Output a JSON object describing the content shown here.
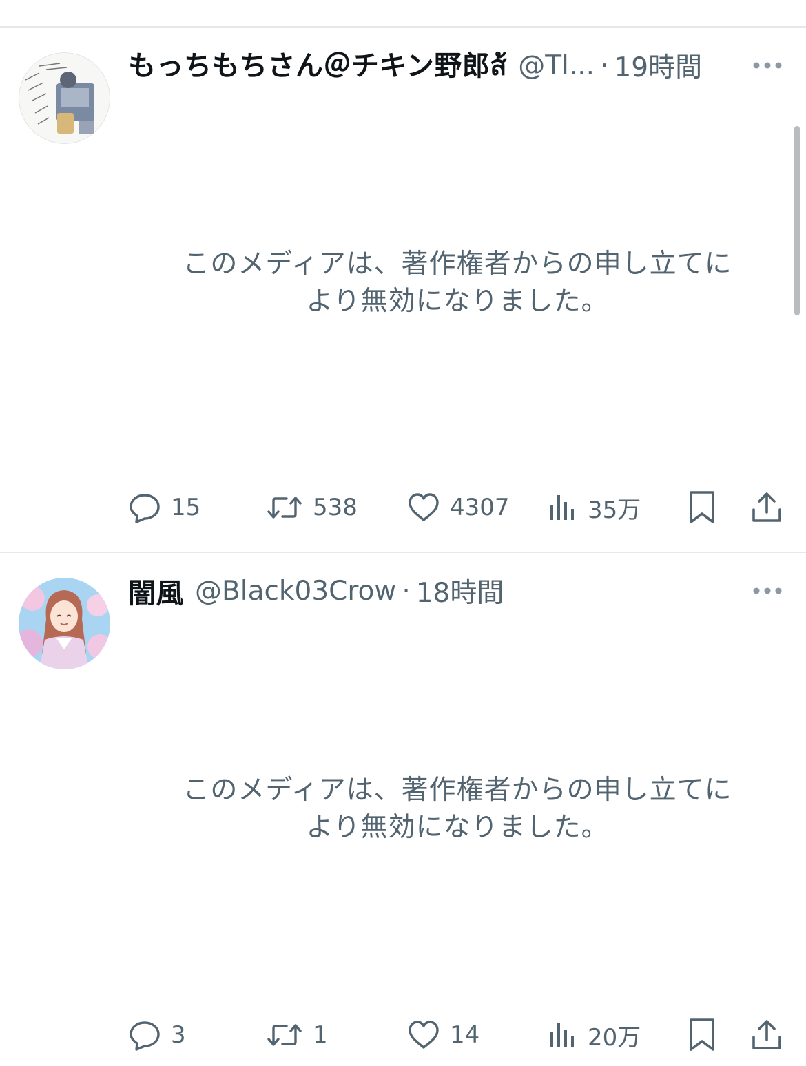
{
  "tweets": [
    {
      "display_name": "もっちもちさん＠チキン野郎ส้",
      "handle": "@Tl...",
      "separator": "·",
      "time": "19時間",
      "media_notice": [
        "このメディアは、著作権者からの申し立てに",
        "より無効になりました。"
      ],
      "stats": {
        "replies": "15",
        "retweets": "538",
        "likes": "4307",
        "views": "35万"
      }
    },
    {
      "display_name": "闇風",
      "handle": "@Black03Crow",
      "separator": "·",
      "time": "18時間",
      "media_notice": [
        "このメディアは、著作権者からの申し立てに",
        "より無効になりました。"
      ],
      "stats": {
        "replies": "3",
        "retweets": "1",
        "likes": "14",
        "views": "20万"
      }
    }
  ],
  "icons": {
    "reply": "speech-bubble-icon",
    "retweet": "retweet-arrows-icon",
    "like": "heart-icon",
    "views": "bar-chart-icon",
    "bookmark": "bookmark-icon",
    "share": "share-upload-icon",
    "more": "ellipsis-icon"
  },
  "colors": {
    "text_primary": "#0f1419",
    "text_secondary": "#536471",
    "divider": "#e6e8ea",
    "background": "#ffffff"
  }
}
